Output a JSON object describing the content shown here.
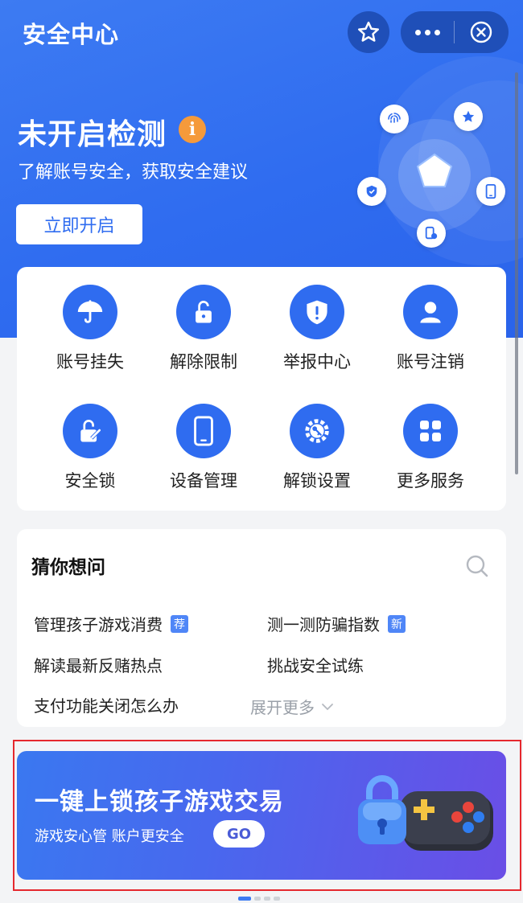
{
  "header": {
    "title": "安全中心",
    "star_icon": "star-outline-icon",
    "more_icon": "more-dots-icon",
    "close_icon": "close-circle-icon"
  },
  "hero": {
    "status": "未开启检测",
    "info_badge": "i",
    "subtitle": "了解账号安全，获取安全建议",
    "button": "立即开启",
    "radar_icons": [
      "fingerprint-icon",
      "star-icon",
      "shield-icon",
      "phone-icon",
      "device-lock-icon"
    ]
  },
  "services": [
    {
      "label": "账号挂失",
      "icon": "umbrella-icon"
    },
    {
      "label": "解除限制",
      "icon": "unlock-icon"
    },
    {
      "label": "举报中心",
      "icon": "shield-alert-icon"
    },
    {
      "label": "账号注销",
      "icon": "user-icon"
    },
    {
      "label": "安全锁",
      "icon": "edit-lock-icon"
    },
    {
      "label": "设备管理",
      "icon": "phone-icon"
    },
    {
      "label": "解锁设置",
      "icon": "gear-key-icon"
    },
    {
      "label": "更多服务",
      "icon": "grid-icon"
    }
  ],
  "faq": {
    "title": "猜你想问",
    "search_icon": "search-icon",
    "items": [
      {
        "text": "管理孩子游戏消费",
        "tag": "荐"
      },
      {
        "text": "测一测防骗指数",
        "tag": "新"
      },
      {
        "text": "解读最新反赌热点",
        "tag": ""
      },
      {
        "text": "挑战安全试练",
        "tag": ""
      },
      {
        "text": "支付功能关闭怎么办",
        "tag": ""
      }
    ],
    "more": "展开更多"
  },
  "banner": {
    "title": "一键上锁孩子游戏交易",
    "subtitle": "游戏安心管 账户更安全",
    "button": "GO"
  },
  "pager": {
    "count": 4,
    "active": 0
  },
  "colors": {
    "primary": "#2f6cf0",
    "accent_orange": "#f59a3b",
    "highlight_border": "#e5282e"
  }
}
